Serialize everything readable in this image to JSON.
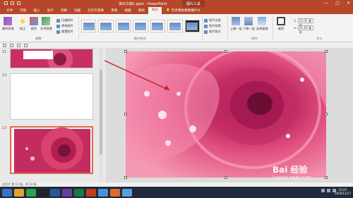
{
  "window": {
    "doc_title": "演示文稿1.pptx - PowerPoint",
    "context_tab": "图片工具"
  },
  "tabs": [
    "文件",
    "开始",
    "插入",
    "设计",
    "切换",
    "动画",
    "幻灯片放映",
    "审阅",
    "视图",
    "帮助",
    "格式"
  ],
  "tab_search": "告诉我你想要做什么",
  "ribbon": {
    "remove_bg": "删除背景",
    "correct": "校正",
    "color": "颜色",
    "art_effects": "艺术效果",
    "compress": "压缩图片",
    "change": "更改图片",
    "reset": "重置图片",
    "adjust_group": "调整",
    "styles_group": "图片样式",
    "border": "图片边框",
    "effects": "图片效果",
    "layout": "图片版式",
    "bring_forward": "上移一层",
    "send_backward": "下移一层",
    "selection_pane": "选择窗格",
    "arrange_group": "排列",
    "crop": "裁剪",
    "size_group": "大小",
    "height_label": "",
    "height_value": "15.05 厘米",
    "width_value": "26.46 厘米"
  },
  "thumbnails": [
    {
      "num": "11"
    },
    {
      "num": "12"
    },
    {
      "num": "13"
    }
  ],
  "status": "幻灯片 第 13 张，共 13 张",
  "watermark": {
    "main": "Bai 经验",
    "sub": "jingyan.baidu.com"
  },
  "clock": {
    "time": "15:07",
    "date": "2020/11/17"
  },
  "colors": {
    "accent": "#b7472a",
    "selection": "#e06a4b",
    "rose": "#d0336a"
  }
}
